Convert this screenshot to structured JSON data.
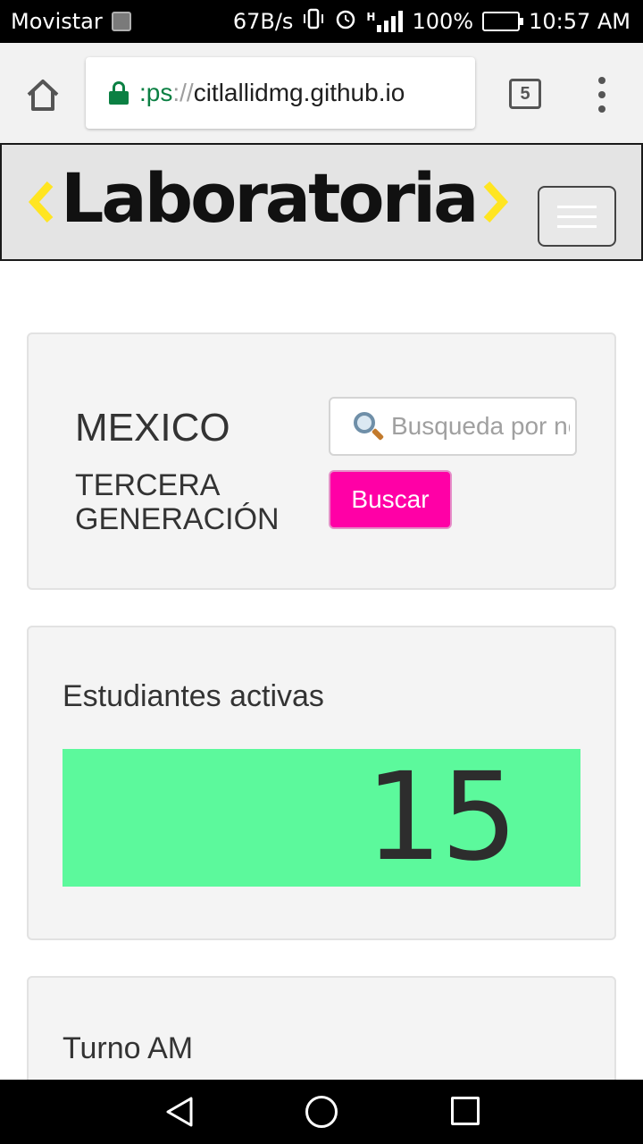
{
  "status_bar": {
    "carrier": "Movistar",
    "speed": "67B/s",
    "network_type": "H",
    "battery": "100%",
    "time": "10:57 AM"
  },
  "browser": {
    "url_scheme": ":ps",
    "url_sep": "://",
    "url_host": "citlallidmg.github.io",
    "tab_count": "5"
  },
  "navbar": {
    "logo_text": "Laboratoria",
    "logo_accent": "#ffe521"
  },
  "filter_card": {
    "country": "MEXICO",
    "generation": "TERCERA GENERACIÓN",
    "search_placeholder": "Busqueda por nombre",
    "search_button": "Buscar",
    "button_color": "#ff00a6"
  },
  "students_card": {
    "title": "Estudiantes activas",
    "count": "15",
    "count_bg": "#5cf99c"
  },
  "shift_card": {
    "title": "Turno AM"
  },
  "icons": [
    "image-notification-icon",
    "vibrate-icon",
    "alarm-icon",
    "signal-icon",
    "battery-icon",
    "home-icon",
    "lock-icon",
    "tabs-icon",
    "overflow-menu-icon",
    "hamburger-icon",
    "search-icon",
    "back-icon",
    "home-nav-icon",
    "recents-icon"
  ]
}
